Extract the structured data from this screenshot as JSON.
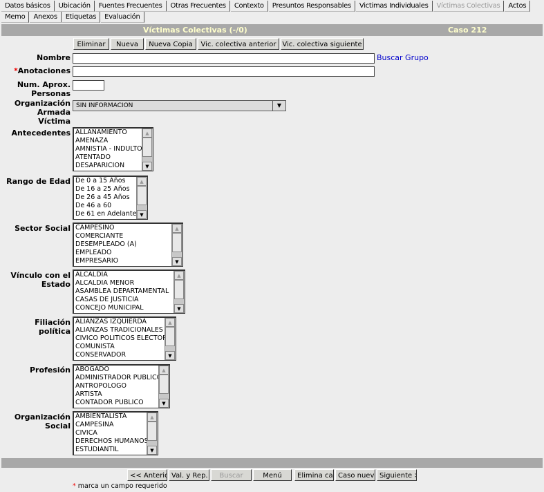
{
  "tabs": [
    "Datos básicos",
    "Ubicación",
    "Fuentes Frecuentes",
    "Otras Frecuentes",
    "Contexto",
    "Presuntos Responsables",
    "Victimas Individuales",
    "Víctimas Colectivas",
    "Actos",
    "Memo",
    "Anexos",
    "Etiquetas",
    "Evaluación"
  ],
  "active_tab": "Víctimas Colectivas",
  "header": {
    "title": "Víctimas Colectivas (-/0)",
    "case": "Caso 212"
  },
  "toolbar": [
    "Eliminar",
    "Nueva",
    "Nueva Copia",
    "Vic. colectiva anterior",
    "Vic. colectiva siguiente"
  ],
  "form": {
    "nombre": {
      "label": "Nombre",
      "value": "",
      "link": "Buscar Grupo"
    },
    "anotaciones": {
      "label": "Anotaciones",
      "required_mark": "*",
      "value": ""
    },
    "num_personas": {
      "label": "Num. Aprox. Personas",
      "value": ""
    },
    "organizacion_armada": {
      "label": "Organización Armada Víctima",
      "value": "SIN INFORMACION"
    },
    "antecedentes": {
      "label": "Antecedentes",
      "items": [
        "ALLANAMIENTO",
        "AMENAZA",
        "AMNISTIA - INDULTO",
        "ATENTADO",
        "DESAPARICION"
      ]
    },
    "rango_edad": {
      "label": "Rango de Edad",
      "items": [
        "De 0 a 15 Años",
        "De 16 a 25 Años",
        "De 26 a 45 Años",
        "De 46 a 60",
        "De 61 en Adelante"
      ]
    },
    "sector_social": {
      "label": "Sector Social",
      "items": [
        "CAMPESINO",
        "COMERCIANTE",
        "DESEMPLEADO (A)",
        "EMPLEADO",
        "EMPRESARIO"
      ]
    },
    "vinculo_estado": {
      "label": "Vínculo con el Estado",
      "items": [
        "ALCALDIA",
        "ALCALDIA MENOR",
        "ASAMBLEA DEPARTAMENTAL",
        "CASAS DE JUSTICIA",
        "CONCEJO MUNICIPAL"
      ]
    },
    "filiacion": {
      "label": "Filiación política",
      "items": [
        "ALIANZAS IZQUIERDA",
        "ALIANZAS TRADICIONALES",
        "CIVICO POLITICOS ELECTORA",
        "COMUNISTA",
        "CONSERVADOR"
      ]
    },
    "profesion": {
      "label": "Profesión",
      "items": [
        "ABOGADO",
        "ADMINISTRADOR PUBLICO",
        "ANTROPOLOGO",
        "ARTISTA",
        "CONTADOR PUBLICO"
      ]
    },
    "organizacion_social": {
      "label": "Organización Social",
      "items": [
        "AMBIENTALISTA",
        "CAMPESINA",
        "CIVICA",
        "DERECHOS HUMANOS",
        "ESTUDIANTIL"
      ]
    }
  },
  "footer_buttons": [
    "<< Anterior",
    "Val. y Rep. Gral",
    "Buscar",
    "Menú",
    "Elimina caso",
    "Caso nuevo",
    "Siguiente >>"
  ],
  "footnote": {
    "mark": "*",
    "text": "marca un campo requerido"
  }
}
